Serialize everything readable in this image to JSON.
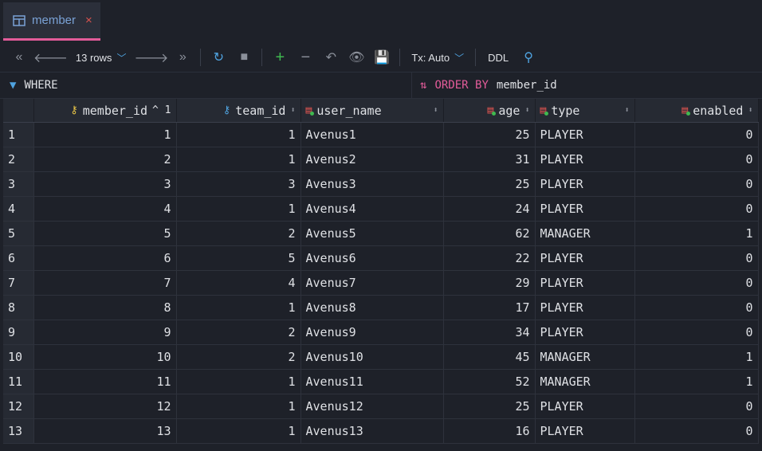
{
  "tab": {
    "label": "member",
    "close": "×"
  },
  "toolbar": {
    "rows_label": "13 rows",
    "tx_label": "Tx: Auto",
    "ddl_label": "DDL"
  },
  "filter": {
    "where_label": "WHERE",
    "order_keyword": "ORDER BY",
    "order_value": "member_id"
  },
  "columns": [
    {
      "name": "member_id",
      "sort_indicator": "^ 1"
    },
    {
      "name": "team_id"
    },
    {
      "name": "user_name"
    },
    {
      "name": "age"
    },
    {
      "name": "type"
    },
    {
      "name": "enabled"
    }
  ],
  "rows": [
    [
      "1",
      "1",
      "1",
      "Avenus1",
      "25",
      "PLAYER",
      "0"
    ],
    [
      "2",
      "2",
      "1",
      "Avenus2",
      "31",
      "PLAYER",
      "0"
    ],
    [
      "3",
      "3",
      "3",
      "Avenus3",
      "25",
      "PLAYER",
      "0"
    ],
    [
      "4",
      "4",
      "1",
      "Avenus4",
      "24",
      "PLAYER",
      "0"
    ],
    [
      "5",
      "5",
      "2",
      "Avenus5",
      "62",
      "MANAGER",
      "1"
    ],
    [
      "6",
      "6",
      "5",
      "Avenus6",
      "22",
      "PLAYER",
      "0"
    ],
    [
      "7",
      "7",
      "4",
      "Avenus7",
      "29",
      "PLAYER",
      "0"
    ],
    [
      "8",
      "8",
      "1",
      "Avenus8",
      "17",
      "PLAYER",
      "0"
    ],
    [
      "9",
      "9",
      "2",
      "Avenus9",
      "34",
      "PLAYER",
      "0"
    ],
    [
      "10",
      "10",
      "2",
      "Avenus10",
      "45",
      "MANAGER",
      "1"
    ],
    [
      "11",
      "11",
      "1",
      "Avenus11",
      "52",
      "MANAGER",
      "1"
    ],
    [
      "12",
      "12",
      "1",
      "Avenus12",
      "25",
      "PLAYER",
      "0"
    ],
    [
      "13",
      "13",
      "1",
      "Avenus13",
      "16",
      "PLAYER",
      "0"
    ]
  ]
}
